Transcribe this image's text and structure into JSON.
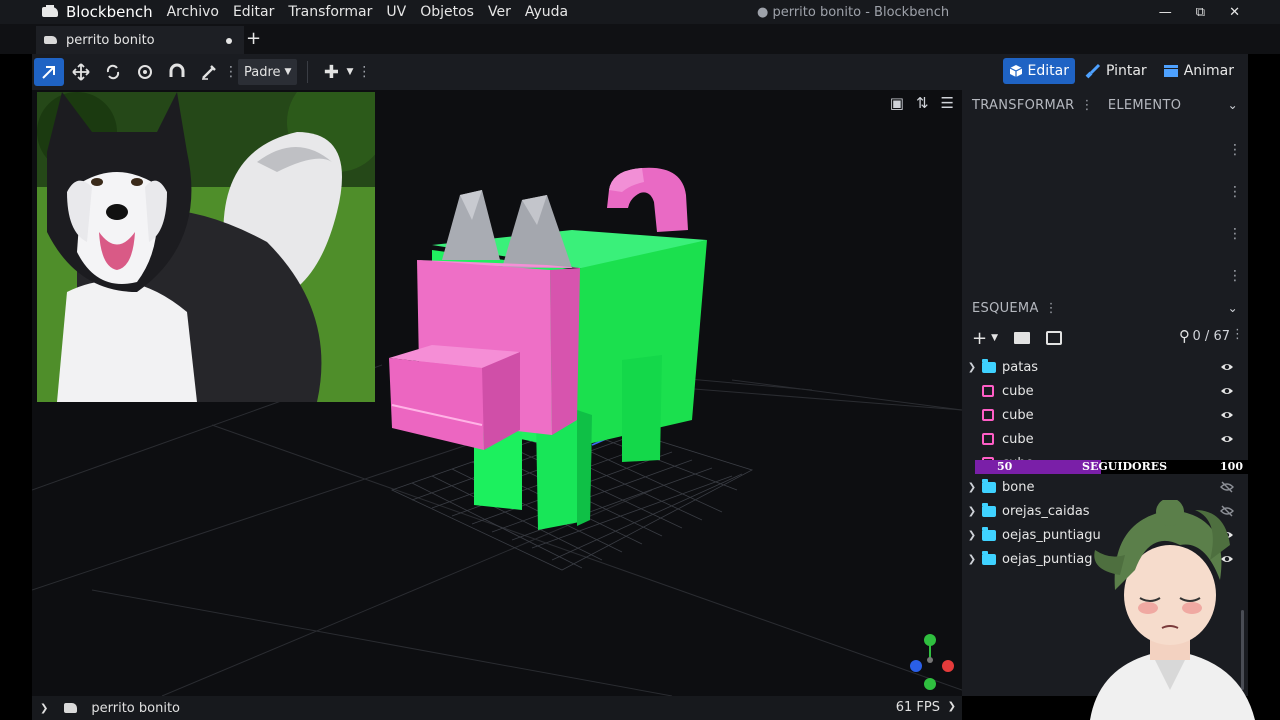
{
  "app": {
    "name": "Blockbench",
    "window_title": "● perrito bonito - Blockbench",
    "menu": [
      "Archivo",
      "Editar",
      "Transformar",
      "UV",
      "Objetos",
      "Ver",
      "Ayuda"
    ]
  },
  "tab": {
    "label": "perrito bonito",
    "add": "+"
  },
  "toolbar": {
    "pivot_select": "Padre",
    "modes": [
      {
        "label": "Editar",
        "active": true
      },
      {
        "label": "Pintar",
        "active": false
      },
      {
        "label": "Animar",
        "active": false
      }
    ]
  },
  "panel": {
    "transform_tab": "TRANSFORMAR",
    "element_tab": "ELEMENTO",
    "outliner_title": "ESQUEMA",
    "count": "0 / 67",
    "items": [
      {
        "label": "patas",
        "type": "folder",
        "expanded": false,
        "visible": true
      },
      {
        "label": "cube",
        "type": "cube",
        "visible": true
      },
      {
        "label": "cube",
        "type": "cube",
        "visible": true
      },
      {
        "label": "cube",
        "type": "cube",
        "visible": true
      },
      {
        "label": "cube",
        "type": "cube",
        "visible": true
      },
      {
        "label": "bone",
        "type": "folder",
        "expanded": false,
        "visible": false
      },
      {
        "label": "orejas_caidas",
        "type": "folder",
        "expanded": false,
        "visible": false
      },
      {
        "label": "oejas_puntiagu",
        "type": "folder",
        "expanded": false,
        "visible": true
      },
      {
        "label": "oejas_puntiag",
        "type": "folder",
        "expanded": false,
        "visible": true
      }
    ]
  },
  "followers_bar": {
    "min": "50",
    "label": "SEGUIDORES",
    "max": "100",
    "progress": 0.45
  },
  "status": {
    "project": "perrito bonito",
    "fps": "61 FPS"
  },
  "colors": {
    "accent": "#1f63c4",
    "cube": "#ff5ec6",
    "folder": "#3fd2ff",
    "body_green": "#1eea5c",
    "head_pink": "#ee6fc6"
  }
}
